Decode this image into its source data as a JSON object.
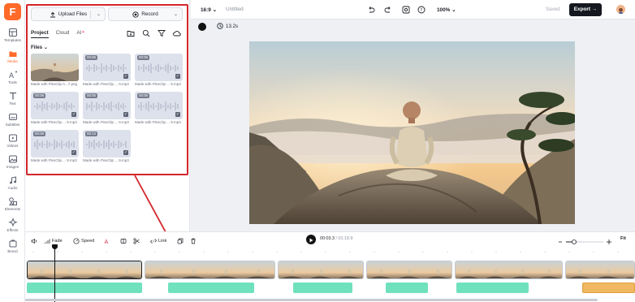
{
  "app": {
    "logo_letter": "F",
    "brand_color": "#ff6a2a"
  },
  "rail": {
    "items": [
      {
        "label": "Templates",
        "icon": "templates-icon"
      },
      {
        "label": "Media",
        "icon": "media-icon",
        "active": true
      },
      {
        "label": "Tools",
        "icon": "ai-tools-icon"
      },
      {
        "label": "Text",
        "icon": "text-icon"
      },
      {
        "label": "Subtitles",
        "icon": "subtitles-icon"
      },
      {
        "label": "Videos",
        "icon": "videos-icon"
      },
      {
        "label": "Images",
        "icon": "images-icon"
      },
      {
        "label": "Audio",
        "icon": "audio-icon"
      },
      {
        "label": "Elements",
        "icon": "elements-icon"
      },
      {
        "label": "Effects",
        "icon": "effects-icon"
      },
      {
        "label": "Brand",
        "icon": "brand-icon"
      }
    ]
  },
  "panel": {
    "upload_label": "Upload Files",
    "record_label": "Record",
    "tabs": [
      {
        "label": "Project",
        "active": true
      },
      {
        "label": "Cloud"
      },
      {
        "label": "AI"
      }
    ],
    "files_label": "Files",
    "files": [
      {
        "type": "image",
        "caption": "Made with FlexClip A...7.png"
      },
      {
        "type": "audio",
        "duration": "00:06",
        "caption": "Made with FlexClip ... 9.mp3"
      },
      {
        "type": "audio",
        "duration": "00:06",
        "caption": "Made with FlexClip ... 9.mp3"
      },
      {
        "type": "audio",
        "duration": "00:08",
        "caption": "Made with FlexClip ... 9.mp3"
      },
      {
        "type": "audio",
        "duration": "00:05",
        "caption": "Made with FlexClip ... 9.mp3"
      },
      {
        "type": "audio",
        "duration": "00:08",
        "caption": "Made with FlexClip ... 9.mp3"
      },
      {
        "type": "audio",
        "duration": "00:09",
        "caption": "Made with FlexClip ... 9.mp3"
      },
      {
        "type": "audio",
        "duration": "00:13",
        "caption": "Made with FlexClip ... 9.mp3"
      }
    ]
  },
  "topbar": {
    "ratio": "16:9",
    "title": "Untitled",
    "zoom": "100%",
    "saved": "Saved",
    "export_label": "Export"
  },
  "subbar": {
    "duration": "13.2s"
  },
  "timeline": {
    "tools": {
      "fade": "Fade",
      "speed": "Speed",
      "link": "Link"
    },
    "current_time": "00:03.3",
    "total_time": "01:19.9",
    "fit_label": "Fit",
    "audio_color": "#6fe1bd",
    "selected_audio_color": "#f0b860"
  }
}
